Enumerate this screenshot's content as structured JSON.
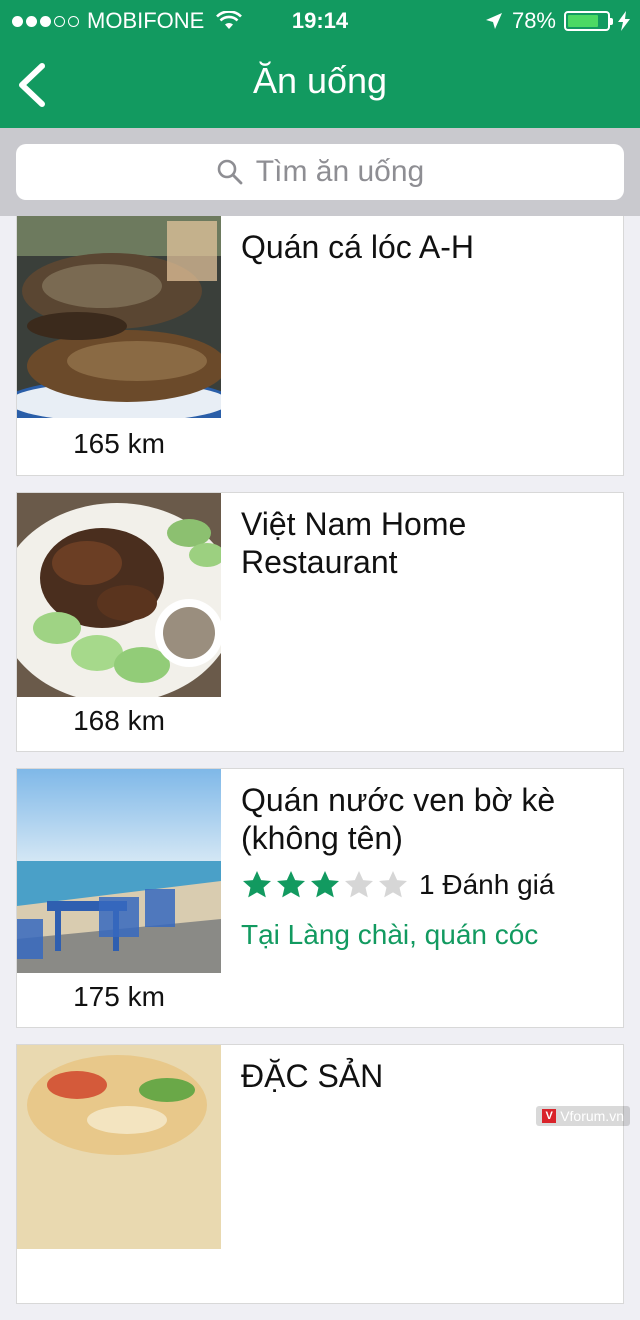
{
  "status": {
    "carrier": "MOBIFONE",
    "time": "19:14",
    "battery": "78%",
    "battery_level": 0.78
  },
  "nav": {
    "title": "Ăn uống"
  },
  "search": {
    "placeholder": "Tìm ăn uống"
  },
  "places": [
    {
      "name": "Quán cá lóc A-H",
      "distance": "165 km"
    },
    {
      "name": "Việt Nam Home Restaurant",
      "distance": "168 km"
    },
    {
      "name": "Quán nước ven bờ kè (không tên)",
      "distance": "175 km",
      "rating": 3,
      "rating_max": 5,
      "reviews": "1 Đánh giá",
      "tags": "Tại Làng chài, quán cóc"
    },
    {
      "name": "ĐẶC SẢN"
    }
  ],
  "watermark": {
    "text": "Vforum.vn"
  },
  "colors": {
    "brand": "#129a60",
    "star_on": "#129a60",
    "star_off": "#d6d6d6"
  }
}
